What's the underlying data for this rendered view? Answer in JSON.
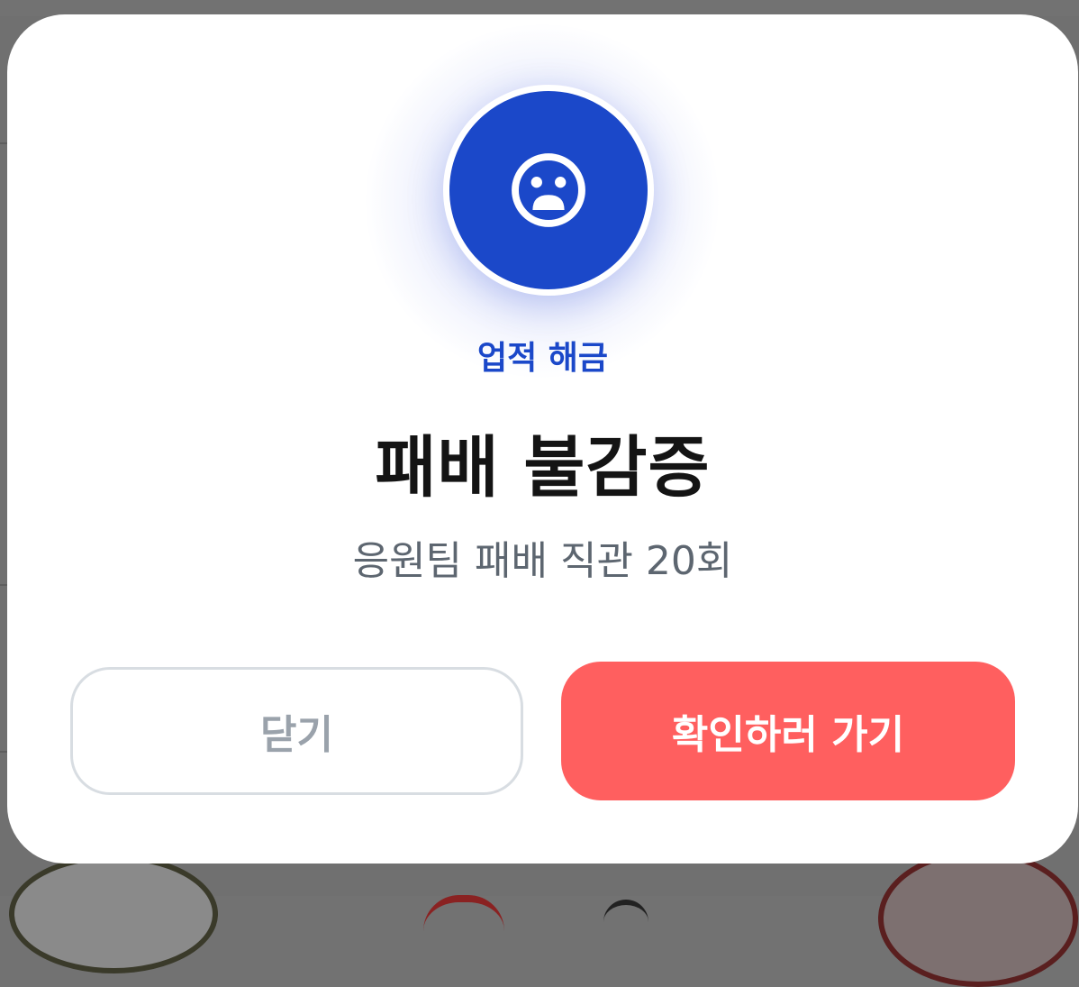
{
  "modal": {
    "icon": "sad-face-icon",
    "eyebrow": "업적 해금",
    "title": "패배 불감증",
    "description": "응원팀 패배 직관 20회",
    "close_label": "닫기",
    "confirm_label": "확인하러 가기"
  },
  "colors": {
    "accent_blue": "#1b48c9",
    "confirm_red": "#ff5f5f",
    "overlay": "#707070"
  }
}
